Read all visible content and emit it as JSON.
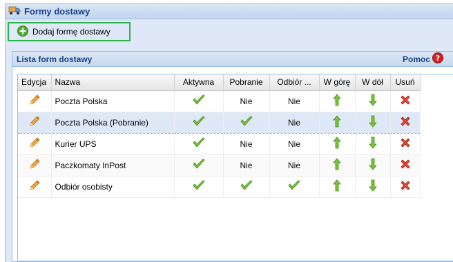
{
  "window": {
    "title": "Formy dostawy"
  },
  "toolbar": {
    "add_label": "Dodaj formę dostawy"
  },
  "panel": {
    "title": "Lista form dostawy",
    "help_label": "Pomoc"
  },
  "grid": {
    "columns": [
      "Edycja",
      "Nazwa",
      "Aktywna",
      "Pobranie",
      "Odbiór ...",
      "W górę",
      "W dół",
      "Usuń"
    ],
    "rows": [
      {
        "name": "Poczta Polska",
        "active": "check",
        "cod": "Nie",
        "pickup": "Nie"
      },
      {
        "name": "Poczta Polska (Pobranie)",
        "active": "check",
        "cod": "check",
        "pickup": "Nie"
      },
      {
        "name": "Kurier UPS",
        "active": "check",
        "cod": "Nie",
        "pickup": "Nie"
      },
      {
        "name": "Paczkomaty InPost",
        "active": "check",
        "cod": "Nie",
        "pickup": "Nie"
      },
      {
        "name": "Odbiór osobisty",
        "active": "check",
        "cod": "check",
        "pickup": "check"
      }
    ],
    "selected_row": 1
  },
  "icons": {
    "title": "truck-icon",
    "add": "plus-circle-icon",
    "help": "help-icon",
    "edit": "pencil-icon",
    "check": "check-icon",
    "up": "arrow-up-icon",
    "down": "arrow-down-icon",
    "delete": "delete-icon"
  },
  "colors": {
    "accent": "#15428b",
    "highlight_border": "#2db34a",
    "check": "#6fbf2a",
    "arrow": "#5cb31c",
    "delete": "#e03a3a"
  }
}
